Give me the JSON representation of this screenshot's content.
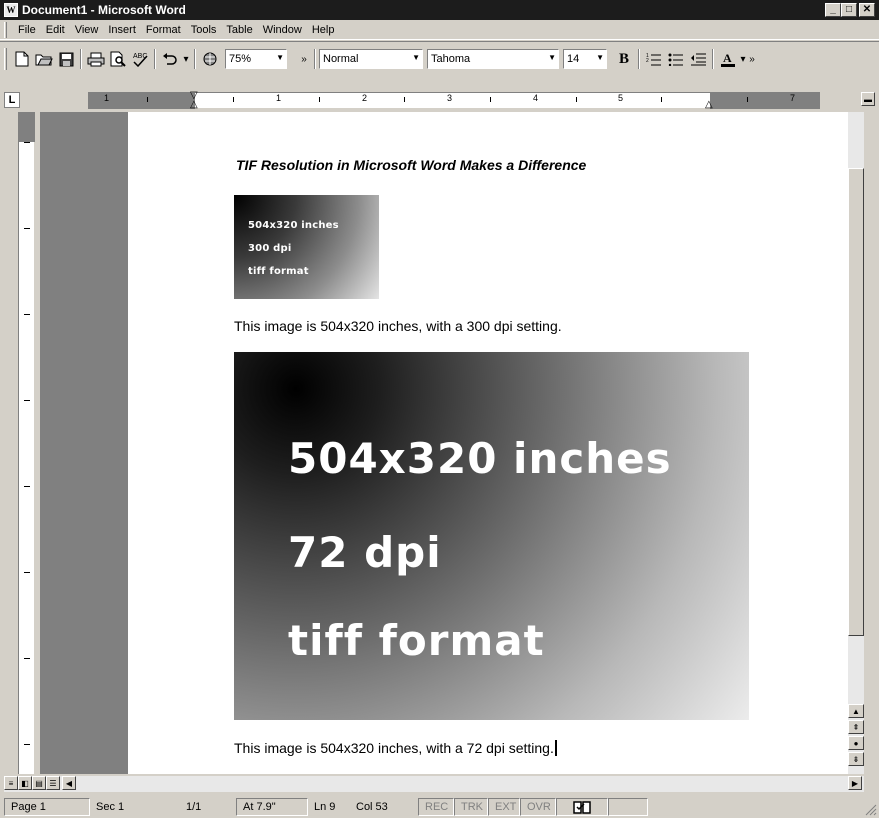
{
  "window": {
    "title": "Document1 - Microsoft Word",
    "app_icon": "word-document-icon",
    "controls": [
      "minimize",
      "maximize",
      "close"
    ]
  },
  "menubar": {
    "items": [
      "File",
      "Edit",
      "View",
      "Insert",
      "Format",
      "Tools",
      "Table",
      "Window",
      "Help"
    ]
  },
  "toolbar": {
    "buttons": [
      "new-document-icon",
      "open-folder-icon",
      "save-icon",
      "print-icon",
      "print-preview-icon",
      "spelling-icon",
      "undo-icon",
      "web-toolbar-icon"
    ],
    "zoom": "75%",
    "style": "Normal",
    "font": "Tahoma",
    "font_size": "14",
    "bold_label": "B"
  },
  "ruler": {
    "corner_label": "L",
    "marks": [
      "1",
      "1",
      "2",
      "3",
      "4",
      "5",
      "7"
    ]
  },
  "document": {
    "heading": "TIF Resolution in Microsoft Word Makes a Difference",
    "small_image_lines": [
      "504x320 inches",
      "300 dpi",
      "tiff format"
    ],
    "caption1": "This image is 504x320 inches, with a 300 dpi setting.",
    "large_image_lines": [
      "504x320 inches",
      "72 dpi",
      "tiff format"
    ],
    "caption2": "This image is 504x320 inches, with a 72 dpi setting."
  },
  "statusbar": {
    "page": "Page 1",
    "sec": "Sec 1",
    "pages": "1/1",
    "at": "At 7.9\"",
    "ln": "Ln 9",
    "col": "Col 53",
    "rec": "REC",
    "trk": "TRK",
    "ext": "EXT",
    "ovr": "OVR"
  }
}
